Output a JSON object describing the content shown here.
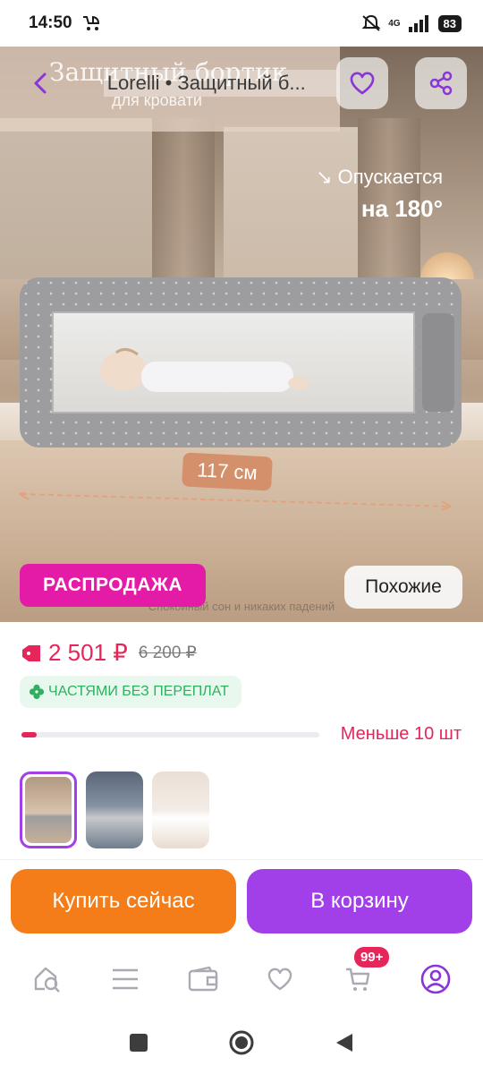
{
  "status_bar": {
    "time": "14:50",
    "network": "4G",
    "battery": "83"
  },
  "header": {
    "title": "Lorelli • Защитный б..."
  },
  "hero": {
    "banner_title": "Защитный бортик",
    "banner_subtitle": "для кровати",
    "caption_line1": "↘ Опускается",
    "caption_line2": "на 180°",
    "dimension_label": "117 см",
    "bottom_caption": "Спокойный сон и никаких падений",
    "sale_badge": "РАСПРОДАЖА",
    "similar_button": "Похожие"
  },
  "price": {
    "current": "2 501 ₽",
    "old": "6 200 ₽",
    "installment": "ЧАСТЯМИ БЕЗ ПЕРЕПЛАТ",
    "stock_label": "Меньше 10 шт",
    "stock_level": 0.05
  },
  "thumbnails": [
    {
      "label": "thumbnail-1",
      "active": true
    },
    {
      "label": "thumbnail-2",
      "active": false
    },
    {
      "label": "thumbnail-3",
      "active": false
    }
  ],
  "actions": {
    "buy_now": "Купить сейчас",
    "add_to_cart": "В корзину"
  },
  "bottom_nav": {
    "cart_badge": "99+"
  },
  "colors": {
    "accent_purple": "#a13fe8",
    "buy_orange": "#f57d19",
    "price_red": "#e6265a",
    "sale_pink": "#e41ba6",
    "installment_green": "#2eb05e"
  },
  "icons": [
    "stroller-icon",
    "mute-icon",
    "signal-icon",
    "back-icon",
    "heart-icon",
    "share-icon",
    "price-tag-icon",
    "clover-icon",
    "search-home-icon",
    "catalog-icon",
    "wallet-icon",
    "favorites-icon",
    "cart-icon",
    "profile-icon"
  ]
}
